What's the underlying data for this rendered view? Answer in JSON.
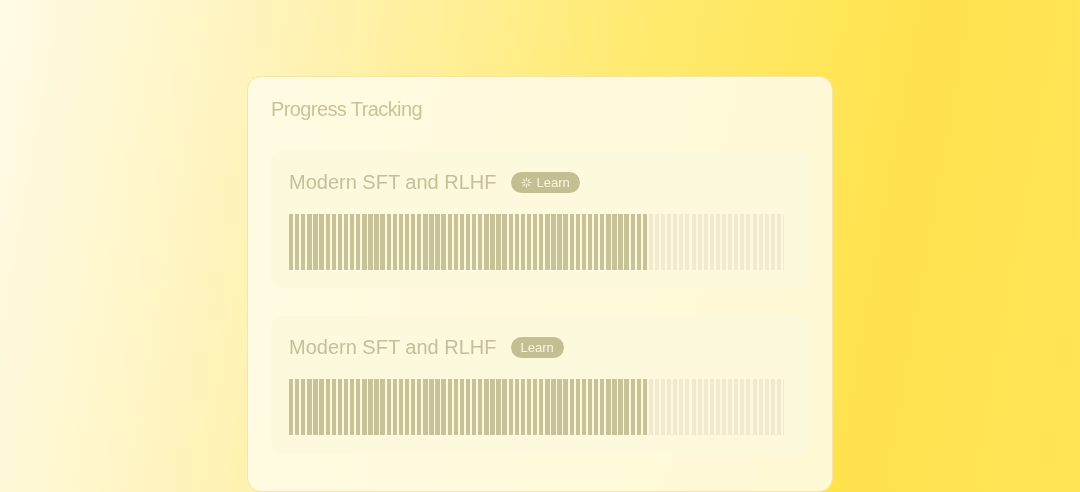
{
  "panel": {
    "title": "Progress Tracking"
  },
  "courses": [
    {
      "name": "Modern SFT and RLHF",
      "badge": "Learn",
      "loading": true,
      "level": 0.725
    },
    {
      "name": "Modern SFT and RLHF",
      "badge": "Learn",
      "loading": false,
      "level": 0.725
    }
  ]
}
